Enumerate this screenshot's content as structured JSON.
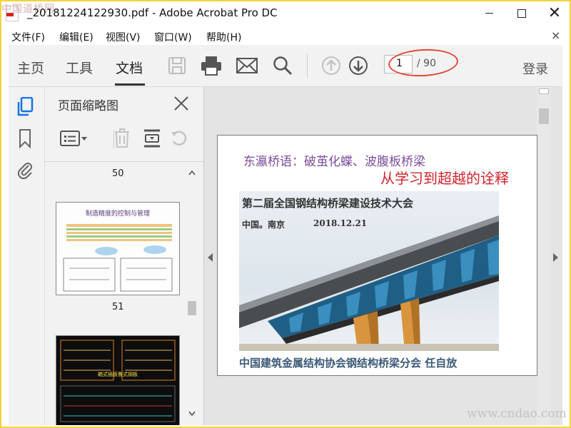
{
  "window": {
    "title": "_20181224122930.pdf - Adobe Acrobat Pro DC",
    "watermark_top": "中国道桥网",
    "close_glyph": "✕"
  },
  "menu": {
    "items": [
      "文件(F)",
      "编辑(E)",
      "视图(V)",
      "窗口(W)",
      "帮助(H)"
    ],
    "close_glyph": "×"
  },
  "toolbar": {
    "tabs": [
      "主页",
      "工具",
      "文档"
    ],
    "active_tab": "文档",
    "current_page": "1",
    "total_pages": "/ 90",
    "login": "登录"
  },
  "thumbnails": {
    "panel_title": "页面缩略图",
    "pages": [
      {
        "label": "50",
        "caption": ""
      },
      {
        "label": "51",
        "caption": "制造精度的控制与管理"
      },
      {
        "label": "",
        "caption": "箱式插板鲁式钢板"
      }
    ]
  },
  "slide": {
    "title_line1": "东瀛桥语：破茧化蝶、波腹板桥梁",
    "title_line2": "从学习到超越的诠释",
    "conference": "第二届全国钢结构桥梁建设技术大会",
    "place": "中国。南京",
    "date": "2018.12.21",
    "footer": "中国建筑金属结构协会钢结构桥梁分会 任自放"
  },
  "watermark_bottom": "www.cndao.com",
  "colors": {
    "accent_red": "#d1232a",
    "title_purple": "#7a4d9b",
    "footer_blue": "#3d5a78",
    "frame_yellow": "#f4d23a"
  }
}
